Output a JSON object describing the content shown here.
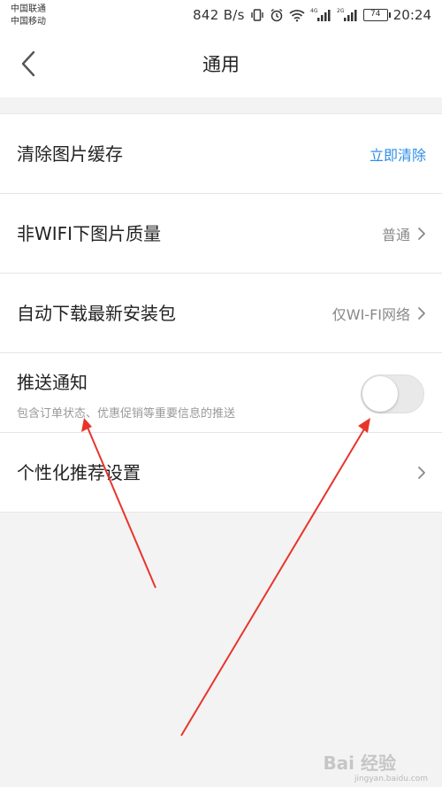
{
  "status_bar": {
    "carrier_1": "中国联通",
    "carrier_2": "中国移动",
    "net_speed": "842 B/s",
    "signal_1_tag": "4G",
    "signal_2_tag": "2G",
    "battery": "74",
    "time": "20:24",
    "icons": [
      "vibrate-icon",
      "alarm-icon",
      "wifi-icon",
      "signal-icon",
      "signal-icon",
      "battery-icon"
    ]
  },
  "navbar": {
    "back_icon": "chevron-left-icon",
    "title": "通用"
  },
  "settings": [
    {
      "title": "清除图片缓存",
      "value": "立即清除"
    },
    {
      "title": "非WIFI下图片质量",
      "value": "普通"
    },
    {
      "title": "自动下载最新安装包",
      "value": "仅WI-FI网络"
    },
    {
      "title": "推送通知",
      "subtitle": "包含订单状态、优惠促销等重要信息的推送",
      "toggle_on": false
    },
    {
      "title": "个性化推荐设置"
    }
  ],
  "colors": {
    "link": "#2d8ee6",
    "annotation_arrow": "#e8352c",
    "toggle_off": "#e9e9e9"
  },
  "watermark": {
    "text": "Bai 经验",
    "sub": "jingyan.baidu.com"
  }
}
